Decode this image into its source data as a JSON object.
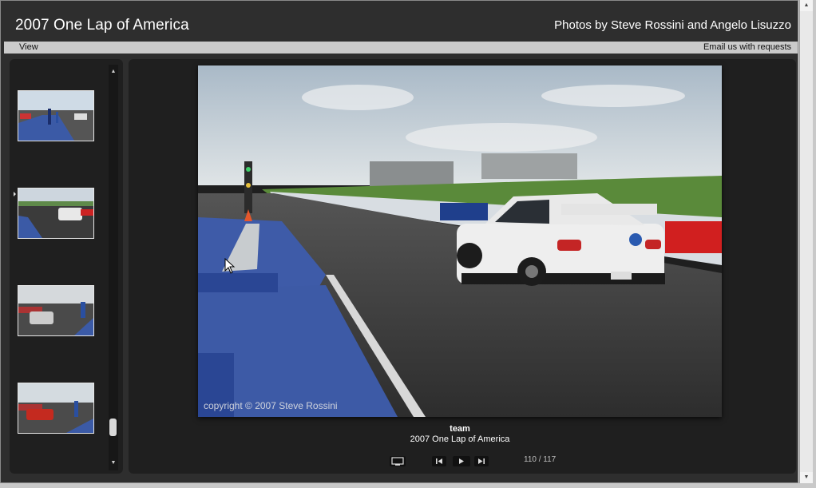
{
  "header": {
    "title": "2007 One Lap of America",
    "credits": "Photos by Steve Rossini and Angelo Lisuzzo"
  },
  "menubar": {
    "view_label": "View",
    "email_label": "Email us with requests"
  },
  "thumbnails": {
    "selected_index": 1,
    "count_visible": 4
  },
  "photo": {
    "copyright": "copyright © 2007 Steve Rossini",
    "caption_title": "team",
    "caption_subtitle": "2007 One Lap of America"
  },
  "controls": {
    "screen_icon": "screen-icon",
    "prev_icon": "previous-icon",
    "play_icon": "play-icon",
    "next_icon": "next-icon",
    "counter": "110 / 117"
  },
  "colors": {
    "background": "#2e2e2e",
    "panel": "#1f1f1f",
    "menubar": "#cbcbcb"
  }
}
